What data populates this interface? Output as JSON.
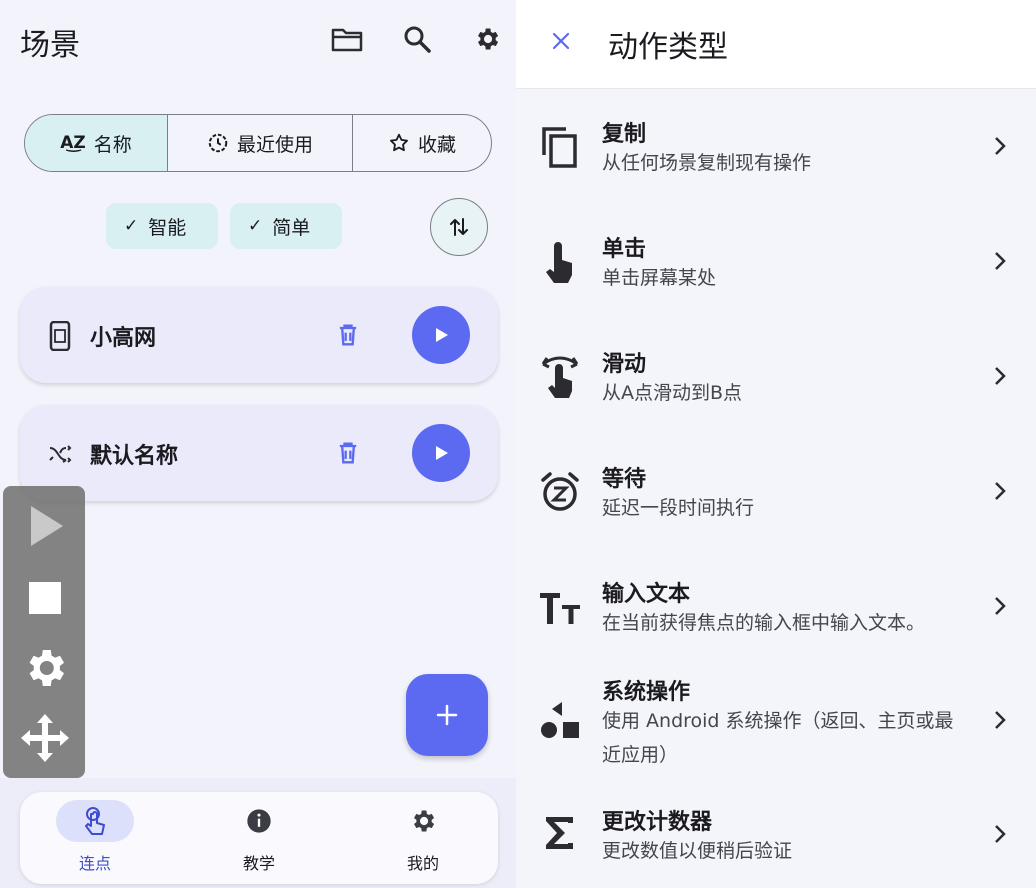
{
  "left": {
    "title": "场景",
    "sort_tabs": [
      "名称",
      "最近使用",
      "收藏"
    ],
    "filters": [
      "智能",
      "简单"
    ],
    "scenes": [
      {
        "name": "小高网",
        "icon": "phone-icon"
      },
      {
        "name": "默认名称",
        "icon": "shuffle-icon"
      }
    ],
    "nav": [
      {
        "label": "连点",
        "icon": "touch-icon"
      },
      {
        "label": "教学",
        "icon": "info-icon"
      },
      {
        "label": "我的",
        "icon": "gear-icon"
      }
    ]
  },
  "dialog": {
    "title": "动作类型",
    "items": [
      {
        "title": "复制",
        "desc": "从任何场景复制现有操作",
        "icon": "copy-icon"
      },
      {
        "title": "单击",
        "desc": "单击屏幕某处",
        "icon": "tap-icon"
      },
      {
        "title": "滑动",
        "desc": "从A点滑动到B点",
        "icon": "swipe-icon"
      },
      {
        "title": "等待",
        "desc": "延迟一段时间执行",
        "icon": "alarm-snooze-icon"
      },
      {
        "title": "输入文本",
        "desc": "在当前获得焦点的输入框中输入文本。",
        "icon": "text-size-icon"
      },
      {
        "title": "系统操作",
        "desc": "使用 Android 系统操作（返回、主页或最近应用）",
        "icon": "shapes-icon"
      },
      {
        "title": "更改计数器",
        "desc": "更改数值以便稍后验证",
        "icon": "sigma-icon"
      }
    ]
  },
  "colors": {
    "accent": "#5b6af0",
    "chip": "#d8f0f2",
    "card": "#eaeafb"
  }
}
